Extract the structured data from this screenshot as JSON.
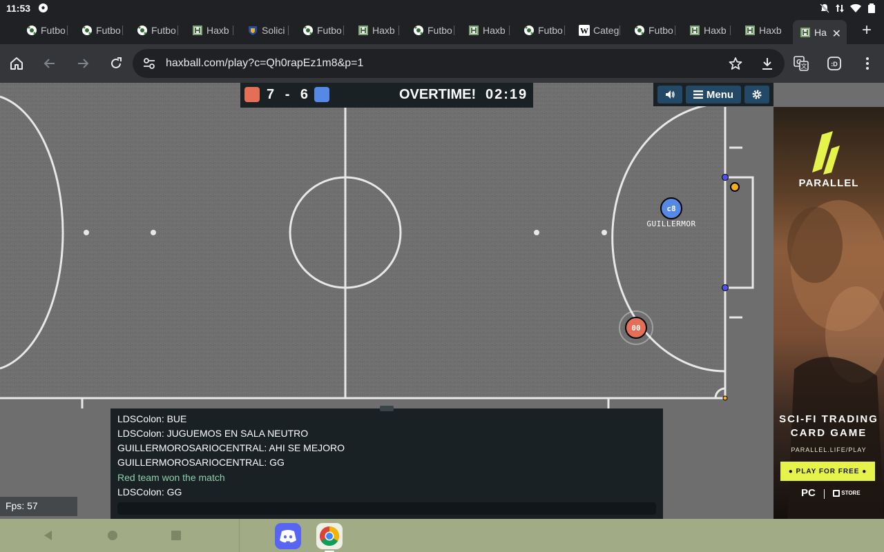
{
  "status_bar": {
    "time": "11:53"
  },
  "tabs": [
    {
      "label": "Futbo",
      "favicon": "soccer-ball-icon"
    },
    {
      "label": "Futbo",
      "favicon": "soccer-ball-icon"
    },
    {
      "label": "Futbo",
      "favicon": "soccer-ball-icon"
    },
    {
      "label": "Haxb",
      "favicon": "haxball-icon"
    },
    {
      "label": "Solici",
      "favicon": "shield-logo-icon"
    },
    {
      "label": "Futbo",
      "favicon": "soccer-ball-icon"
    },
    {
      "label": "Haxb",
      "favicon": "haxball-icon"
    },
    {
      "label": "Futbo",
      "favicon": "soccer-ball-icon"
    },
    {
      "label": "Haxb",
      "favicon": "haxball-icon"
    },
    {
      "label": "Futbo",
      "favicon": "soccer-ball-icon"
    },
    {
      "label": "Categ",
      "favicon": "wikipedia-icon"
    },
    {
      "label": "Futbo",
      "favicon": "soccer-ball-icon"
    },
    {
      "label": "Haxb",
      "favicon": "haxball-icon"
    },
    {
      "label": "Haxb",
      "favicon": "haxball-icon"
    },
    {
      "label": "Ha",
      "favicon": "haxball-icon",
      "active": true
    }
  ],
  "toolbar": {
    "url": "haxball.com/play?c=Qh0rapEz1m8&p=1"
  },
  "scoreboard": {
    "red_score": "7",
    "separator": "-",
    "blue_score": "6",
    "status": "OVERTIME!",
    "clock": "02:19",
    "red_color": "#e56e56",
    "blue_color": "#5689e5"
  },
  "game_controls": {
    "menu_label": "Menu"
  },
  "players": [
    {
      "team": "blue",
      "avatar": "c8",
      "name": "GUILLERMOR"
    },
    {
      "team": "red",
      "avatar": "00",
      "name": ""
    }
  ],
  "chat": {
    "messages": [
      {
        "text": "LDSColon: BUE",
        "type": "user"
      },
      {
        "text": "LDSColon: JUGUEMOS EN SALA NEUTRO",
        "type": "user"
      },
      {
        "text": "GUILLERMOROSARIOCENTRAL: AHI SE MEJORO",
        "type": "user"
      },
      {
        "text": "GUILLERMOROSARIOCENTRAL: GG",
        "type": "user"
      },
      {
        "text": "Red team won the match",
        "type": "system"
      },
      {
        "text": "LDSColon: GG",
        "type": "user"
      }
    ]
  },
  "fps": "Fps: 57",
  "ad": {
    "brand": "PARALLEL",
    "headline": "SCI-FI TRADING CARD GAME",
    "url": "PARALLEL.LIFE/PLAY",
    "cta": "● PLAY FOR FREE ●",
    "platform": "PC",
    "store": "STORE",
    "accent": "#e6f34a"
  }
}
